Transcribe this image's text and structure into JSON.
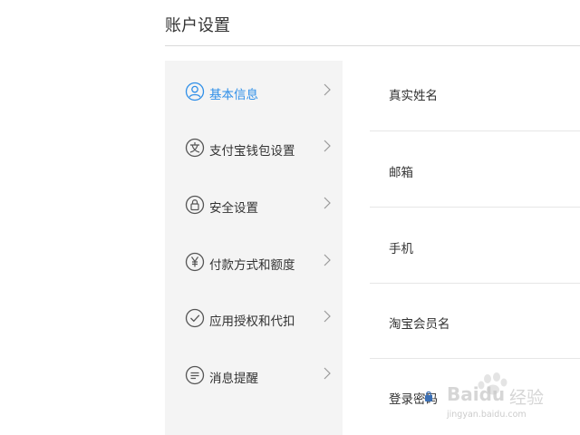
{
  "header": {
    "title": "账户设置"
  },
  "sidebar": {
    "items": [
      {
        "label": "基本信息",
        "icon": "user-icon",
        "active": true
      },
      {
        "label": "支付宝钱包设置",
        "icon": "wallet-icon",
        "active": false
      },
      {
        "label": "安全设置",
        "icon": "lock-icon",
        "active": false
      },
      {
        "label": "付款方式和额度",
        "icon": "yuan-icon",
        "active": false
      },
      {
        "label": "应用授权和代扣",
        "icon": "check-circle-icon",
        "active": false
      },
      {
        "label": "消息提醒",
        "icon": "message-icon",
        "active": false
      }
    ]
  },
  "main": {
    "fields": [
      {
        "label": "真实姓名"
      },
      {
        "label": "邮箱"
      },
      {
        "label": "手机"
      },
      {
        "label": "淘宝会员名"
      },
      {
        "label": "登录密码"
      }
    ]
  },
  "watermark": {
    "brand": "Baidu",
    "suffix": "经验",
    "url": "jingyan.baidu.com"
  },
  "colors": {
    "accent": "#2f8fe8",
    "sidebar_bg": "#f4f4f4",
    "text": "#333333",
    "divider": "#e6e6e6"
  }
}
